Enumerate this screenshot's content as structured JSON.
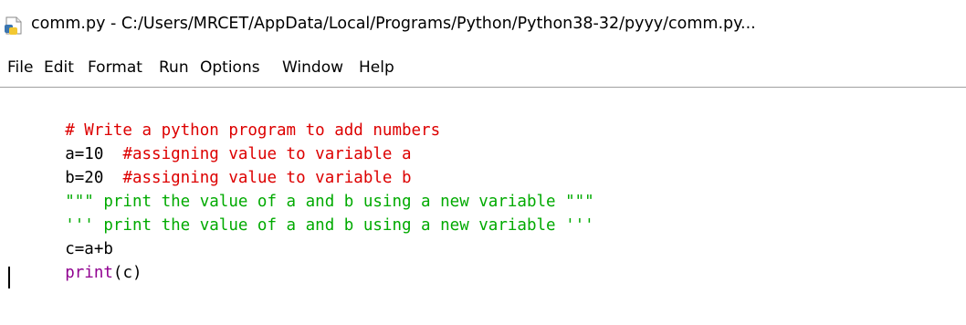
{
  "window": {
    "title": "comm.py - C:/Users/MRCET/AppData/Local/Programs/Python/Python38-32/pyyy/comm.py...",
    "icon": "python-idle-icon"
  },
  "menu": {
    "items": [
      "File",
      "Edit",
      "Format",
      "Run",
      "Options",
      "Window",
      "Help"
    ]
  },
  "editor": {
    "lines": [
      [
        {
          "text": "# Write a python program to add numbers",
          "kind": "comment"
        }
      ],
      [
        {
          "text": "a=10  ",
          "kind": "plain"
        },
        {
          "text": "#assigning value to variable a",
          "kind": "comment"
        }
      ],
      [
        {
          "text": "b=20  ",
          "kind": "plain"
        },
        {
          "text": "#assigning value to variable b",
          "kind": "comment"
        }
      ],
      [
        {
          "text": "\"\"\" print the value of a and b using a new variable \"\"\"",
          "kind": "string"
        }
      ],
      [
        {
          "text": "''' print the value of a and b using a new variable '''",
          "kind": "string"
        }
      ],
      [
        {
          "text": "c=a+b",
          "kind": "plain"
        }
      ],
      [
        {
          "text": "print",
          "kind": "builtin"
        },
        {
          "text": "(c)",
          "kind": "plain"
        }
      ]
    ]
  },
  "colors": {
    "comment": "#dd0000",
    "string": "#00aa00",
    "builtin": "#900090",
    "plain": "#000000"
  }
}
